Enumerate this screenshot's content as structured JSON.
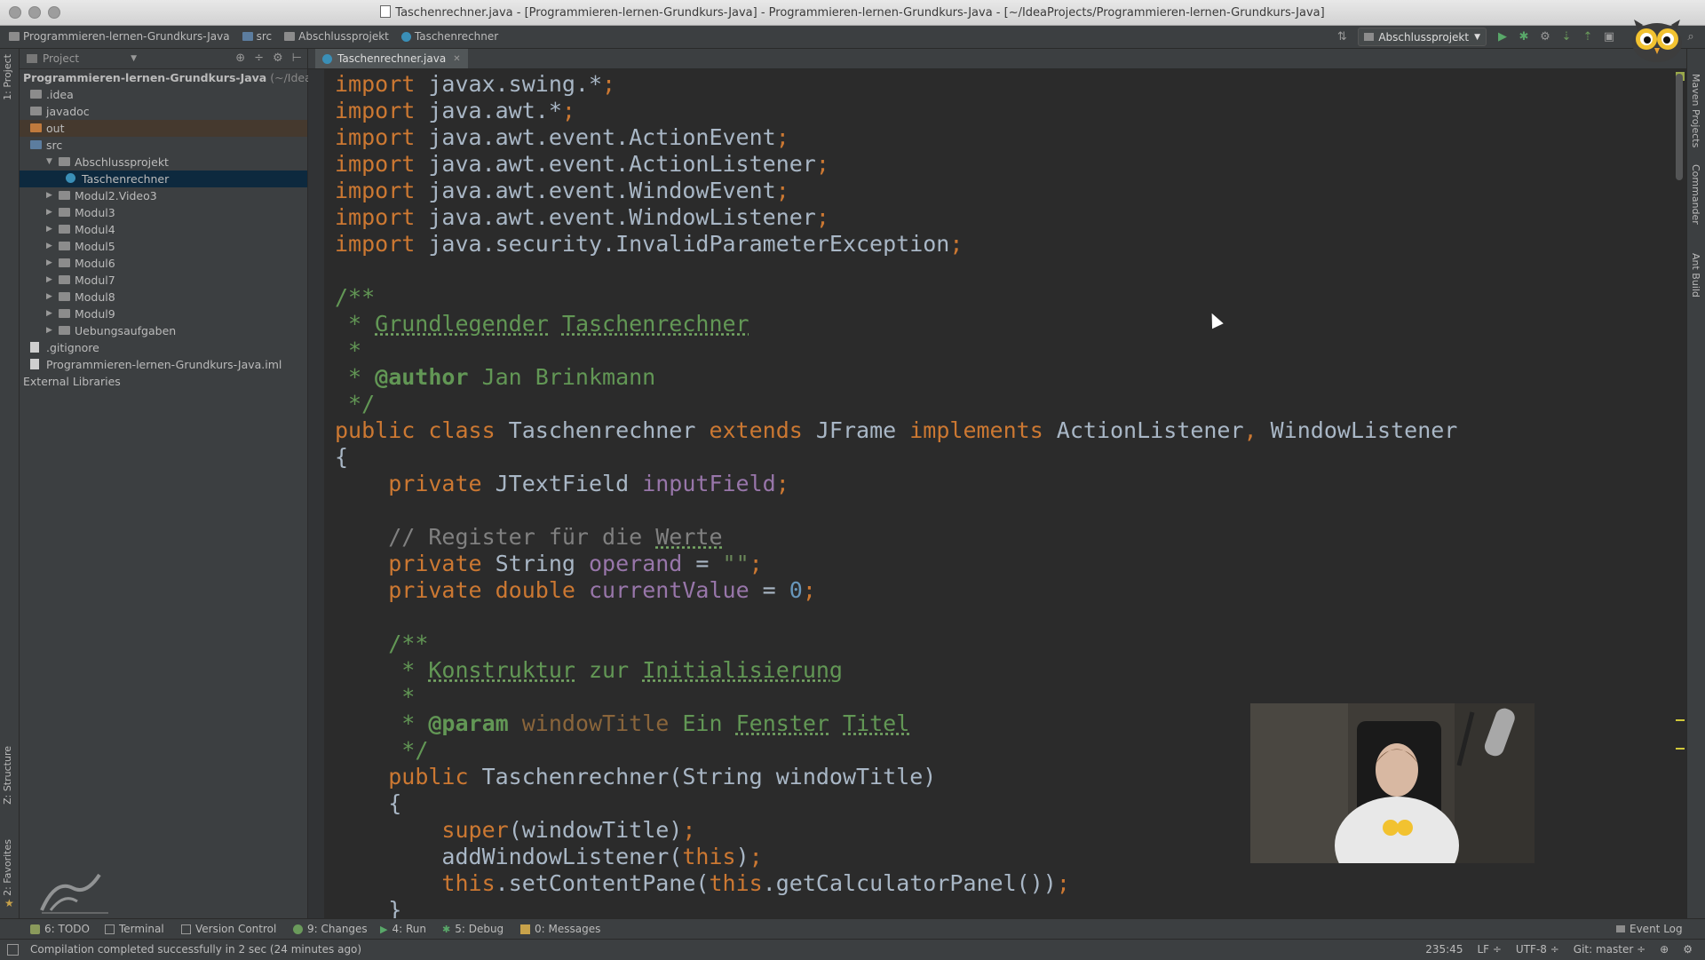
{
  "window": {
    "title": "Taschenrechner.java - [Programmieren-lernen-Grundkurs-Java] - Programmieren-lernen-Grundkurs-Java - [~/IdeaProjects/Programmieren-lernen-Grundkurs-Java]"
  },
  "navbar": {
    "breadcrumbs": [
      "Programmieren-lernen-Grundkurs-Java",
      "src",
      "Abschlussprojekt",
      "Taschenrechner"
    ],
    "run_config": "Abschlussprojekt"
  },
  "project_panel": {
    "selector": "Project",
    "tree": [
      {
        "label": "Programmieren-lernen-Grundkurs-Java",
        "hint": " (~/IdeaPr",
        "depth": 0,
        "type": "root"
      },
      {
        "label": ".idea",
        "depth": 1,
        "type": "folder"
      },
      {
        "label": "javadoc",
        "depth": 1,
        "type": "folder"
      },
      {
        "label": "out",
        "depth": 1,
        "type": "folder-orange"
      },
      {
        "label": "src",
        "depth": 1,
        "type": "folder-blue"
      },
      {
        "label": "Abschlussprojekt",
        "depth": 2,
        "type": "package",
        "expanded": true
      },
      {
        "label": "Taschenrechner",
        "depth": 3,
        "type": "class",
        "selected": true
      },
      {
        "label": "Modul2.Video3",
        "depth": 2,
        "type": "package"
      },
      {
        "label": "Modul3",
        "depth": 2,
        "type": "package"
      },
      {
        "label": "Modul4",
        "depth": 2,
        "type": "package"
      },
      {
        "label": "Modul5",
        "depth": 2,
        "type": "package"
      },
      {
        "label": "Modul6",
        "depth": 2,
        "type": "package"
      },
      {
        "label": "Modul7",
        "depth": 2,
        "type": "package"
      },
      {
        "label": "Modul8",
        "depth": 2,
        "type": "package"
      },
      {
        "label": "Modul9",
        "depth": 2,
        "type": "package"
      },
      {
        "label": "Uebungsaufgaben",
        "depth": 2,
        "type": "package"
      },
      {
        "label": ".gitignore",
        "depth": 1,
        "type": "file"
      },
      {
        "label": "Programmieren-lernen-Grundkurs-Java.iml",
        "depth": 1,
        "type": "file"
      },
      {
        "label": "External Libraries",
        "depth": 0,
        "type": "lib"
      }
    ]
  },
  "editor": {
    "tab": "Taschenrechner.java",
    "lines": [
      [
        [
          "k",
          "import"
        ],
        [
          "p",
          " javax.swing.*"
        ],
        [
          "k",
          ";"
        ]
      ],
      [
        [
          "k",
          "import"
        ],
        [
          "p",
          " java.awt.*"
        ],
        [
          "k",
          ";"
        ]
      ],
      [
        [
          "k",
          "import"
        ],
        [
          "p",
          " java.awt.event.ActionEvent"
        ],
        [
          "k",
          ";"
        ]
      ],
      [
        [
          "k",
          "import"
        ],
        [
          "p",
          " java.awt.event.ActionListener"
        ],
        [
          "k",
          ";"
        ]
      ],
      [
        [
          "k",
          "import"
        ],
        [
          "p",
          " java.awt.event.WindowEvent"
        ],
        [
          "k",
          ";"
        ]
      ],
      [
        [
          "k",
          "import"
        ],
        [
          "p",
          " java.awt.event.WindowListener"
        ],
        [
          "k",
          ";"
        ]
      ],
      [
        [
          "k",
          "import"
        ],
        [
          "p",
          " java.security.InvalidParameterException"
        ],
        [
          "k",
          ";"
        ]
      ],
      [],
      [
        [
          "d",
          "/**"
        ]
      ],
      [
        [
          "d",
          " * "
        ],
        [
          "t",
          "Grundlegender"
        ],
        [
          "d",
          " "
        ],
        [
          "t",
          "Taschenrechner"
        ]
      ],
      [
        [
          "d",
          " *"
        ]
      ],
      [
        [
          "d",
          " * "
        ],
        [
          "tag",
          "@author"
        ],
        [
          "d",
          " Jan Brinkmann"
        ]
      ],
      [
        [
          "d",
          " */"
        ]
      ],
      [
        [
          "k",
          "public class"
        ],
        [
          "p",
          " Taschenrechner "
        ],
        [
          "k",
          "extends"
        ],
        [
          "p",
          " JFrame "
        ],
        [
          "k",
          "implements"
        ],
        [
          "p",
          " ActionListener"
        ],
        [
          "k",
          ","
        ],
        [
          "p",
          " WindowListener"
        ]
      ],
      [
        [
          "p",
          "{"
        ]
      ],
      [
        [
          "p",
          "    "
        ],
        [
          "k",
          "private"
        ],
        [
          "p",
          " JTextField "
        ],
        [
          "f",
          "inputField"
        ],
        [
          "k",
          ";"
        ]
      ],
      [],
      [
        [
          "p",
          "    "
        ],
        [
          "c",
          "// Register für die "
        ],
        [
          "ct",
          "Werte"
        ]
      ],
      [
        [
          "p",
          "    "
        ],
        [
          "k",
          "private"
        ],
        [
          "p",
          " String "
        ],
        [
          "f",
          "operand"
        ],
        [
          "p",
          " = "
        ],
        [
          "s",
          "\"\""
        ],
        [
          "k",
          ";"
        ]
      ],
      [
        [
          "p",
          "    "
        ],
        [
          "k",
          "private double"
        ],
        [
          "p",
          " "
        ],
        [
          "f",
          "currentValue"
        ],
        [
          "p",
          " = "
        ],
        [
          "n",
          "0"
        ],
        [
          "k",
          ";"
        ]
      ],
      [],
      [
        [
          "p",
          "    "
        ],
        [
          "d",
          "/**"
        ]
      ],
      [
        [
          "p",
          "    "
        ],
        [
          "d",
          " * "
        ],
        [
          "t",
          "Konstruktur"
        ],
        [
          "d",
          " zur "
        ],
        [
          "t",
          "Initialisierung"
        ]
      ],
      [
        [
          "p",
          "    "
        ],
        [
          "d",
          " *"
        ]
      ],
      [
        [
          "p",
          "    "
        ],
        [
          "d",
          " * "
        ],
        [
          "tag",
          "@param"
        ],
        [
          "d",
          " "
        ],
        [
          "pv",
          "windowTitle"
        ],
        [
          "d",
          " Ein "
        ],
        [
          "t",
          "Fenster"
        ],
        [
          "d",
          " "
        ],
        [
          "t",
          "Titel"
        ]
      ],
      [
        [
          "p",
          "    "
        ],
        [
          "d",
          " */"
        ]
      ],
      [
        [
          "p",
          "    "
        ],
        [
          "k",
          "public"
        ],
        [
          "p",
          " Taschenrechner(String windowTitle)"
        ]
      ],
      [
        [
          "p",
          "    {"
        ]
      ],
      [
        [
          "p",
          "        "
        ],
        [
          "k",
          "super"
        ],
        [
          "p",
          "(windowTitle)"
        ],
        [
          "k",
          ";"
        ]
      ],
      [
        [
          "p",
          "        addWindowListener("
        ],
        [
          "k",
          "this"
        ],
        [
          "p",
          ")"
        ],
        [
          "k",
          ";"
        ]
      ],
      [
        [
          "p",
          "        "
        ],
        [
          "k",
          "this"
        ],
        [
          "p",
          ".setContentPane("
        ],
        [
          "k",
          "this"
        ],
        [
          "p",
          ".getCalculatorPanel())"
        ],
        [
          "k",
          ";"
        ]
      ],
      [
        [
          "p",
          "    }"
        ]
      ]
    ]
  },
  "side_tabs": {
    "left_top": "1: Project",
    "left_structure": "Z: Structure",
    "left_favorites": "2: Favorites",
    "right": [
      "Maven Projects",
      "Commander",
      "Ant Build"
    ]
  },
  "bottom_tabs": [
    {
      "label": "6: TODO",
      "color": "#8a9a5b"
    },
    {
      "label": "Terminal",
      "color": "#9a9a9a"
    },
    {
      "label": "Version Control",
      "color": "#9a9a9a"
    },
    {
      "label": "9: Changes",
      "color": "#6a9a5b"
    },
    {
      "label": "4: Run",
      "color": "#59a869"
    },
    {
      "label": "5: Debug",
      "color": "#59a869"
    },
    {
      "label": "0: Messages",
      "color": "#c8a24a"
    }
  ],
  "event_log": "Event Log",
  "statusbar": {
    "message": "Compilation completed successfully in 2 sec (24 minutes ago)",
    "position": "235:45",
    "line_sep": "LF ÷",
    "encoding": "UTF-8 ÷",
    "vcs": "Git: master ÷"
  },
  "colors": {
    "keyword": "#cc7832",
    "doc": "#629755",
    "field": "#9876aa",
    "number": "#6897bb",
    "string": "#6a8759",
    "comment": "#808080",
    "selection": "#0d293e"
  }
}
